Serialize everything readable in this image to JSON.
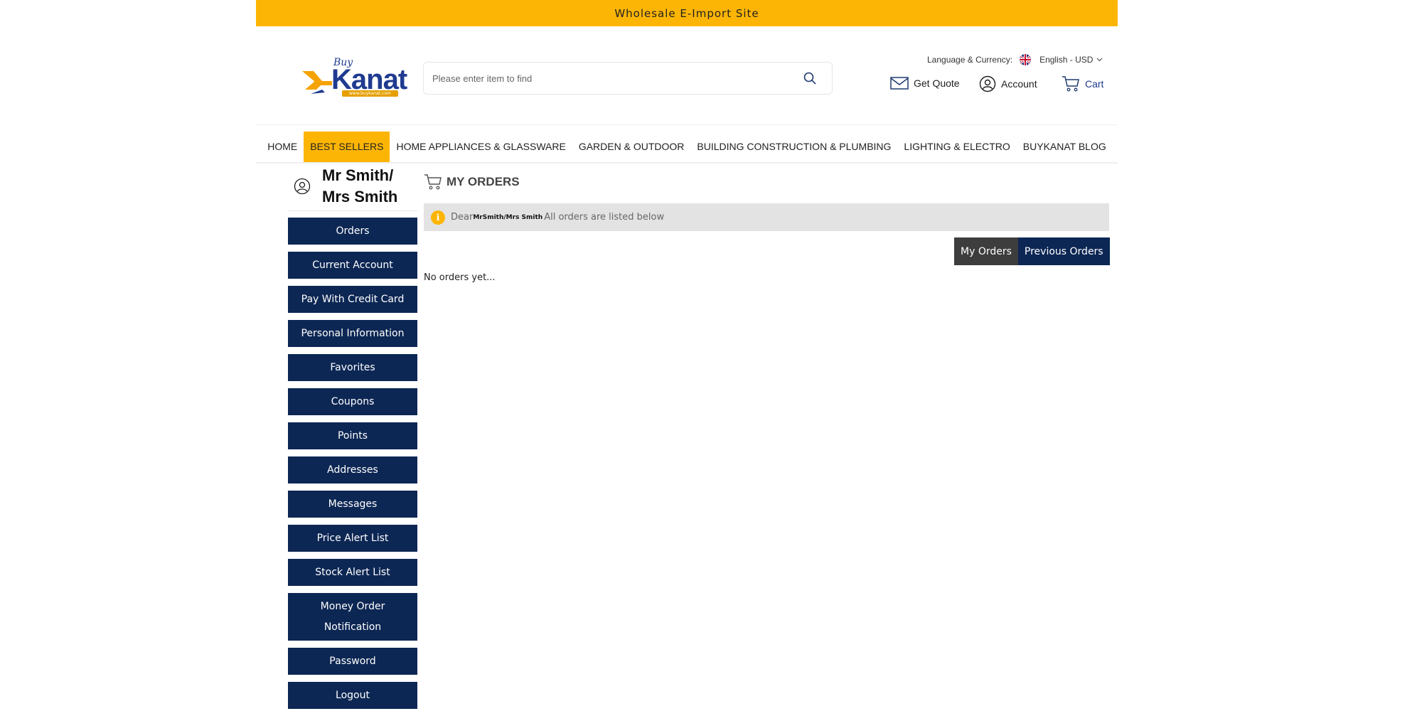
{
  "topbar": {
    "text": "Wholesale E-Import Site"
  },
  "logo": {
    "buy": "Buy",
    "brand": "Kanat",
    "url": "www.buykanat.com"
  },
  "search": {
    "placeholder": "Please enter item to find"
  },
  "language": {
    "label": "Language & Currency:",
    "value": "English - USD"
  },
  "header_links": {
    "quote": "Get Quote",
    "account": "Account",
    "cart": "Cart"
  },
  "main_nav": [
    {
      "label": "HOME"
    },
    {
      "label": "BEST SELLERS",
      "active": true
    },
    {
      "label": "HOME APPLIANCES & GLASSWARE"
    },
    {
      "label": "GARDEN & OUTDOOR"
    },
    {
      "label": "BUILDING CONSTRUCTION & PLUMBING"
    },
    {
      "label": "LIGHTING & ELECTRO"
    },
    {
      "label": "BUYKANAT BLOG"
    }
  ],
  "user": {
    "name": "Mr  Smith/\nMrs Smith"
  },
  "sidebar": {
    "items": [
      {
        "label": "Orders"
      },
      {
        "label": "Current Account"
      },
      {
        "label": "Pay With Credit Card"
      },
      {
        "label": "Personal Information"
      },
      {
        "label": "Favorites"
      },
      {
        "label": "Coupons"
      },
      {
        "label": "Points"
      },
      {
        "label": "Addresses"
      },
      {
        "label": "Messages"
      },
      {
        "label": "Price Alert List"
      },
      {
        "label": "Stock Alert List"
      },
      {
        "label": "Money Order Notification"
      },
      {
        "label": "Password"
      },
      {
        "label": "Logout"
      }
    ]
  },
  "content": {
    "title": "MY ORDERS",
    "alert_prefix": "Dear",
    "alert_name": "MrSmith/Mrs Smith",
    "alert_text": "All orders are listed below",
    "tabs": {
      "my_orders": "My Orders",
      "previous_orders": "Previous Orders"
    },
    "empty": "No orders yet..."
  },
  "colors": {
    "accent": "#fdb505",
    "navy": "#0d2754",
    "dark_tab": "#3d3d3d"
  }
}
